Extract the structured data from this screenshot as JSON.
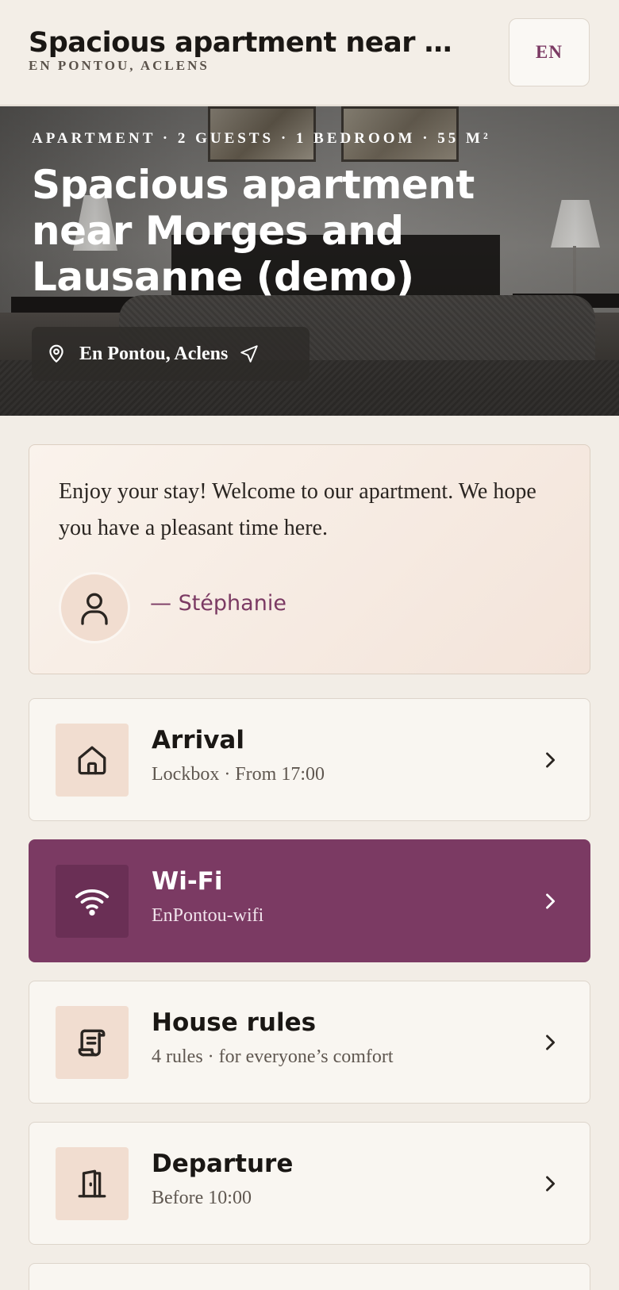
{
  "header": {
    "title": "Spacious apartment near …",
    "subtitle": "En Pontou, Aclens",
    "language": "EN"
  },
  "hero": {
    "meta": "Apartment · 2 guests · 1 bedroom · 55 m²",
    "title": "Spacious apartment near Morges and Lausanne (demo)",
    "location": "En Pontou, Aclens"
  },
  "welcome": {
    "message": "Enjoy your stay! Welcome to our apartment. We hope you have a pleasant time here.",
    "signature": "— Stéphanie"
  },
  "sections": [
    {
      "title": "Arrival",
      "subtitle": "Lockbox · From 17:00",
      "icon": "house-icon"
    },
    {
      "title": "Wi-Fi",
      "subtitle": "EnPontou-wifi",
      "icon": "wifi-icon"
    },
    {
      "title": "House rules",
      "subtitle": "4 rules · for everyone’s comfort",
      "icon": "scroll-icon"
    },
    {
      "title": "Departure",
      "subtitle": "Before 10:00",
      "icon": "door-icon"
    }
  ],
  "colors": {
    "accent": "#7b3a63",
    "background": "#f2ede6",
    "icon_tile": "#f1ddd0"
  }
}
